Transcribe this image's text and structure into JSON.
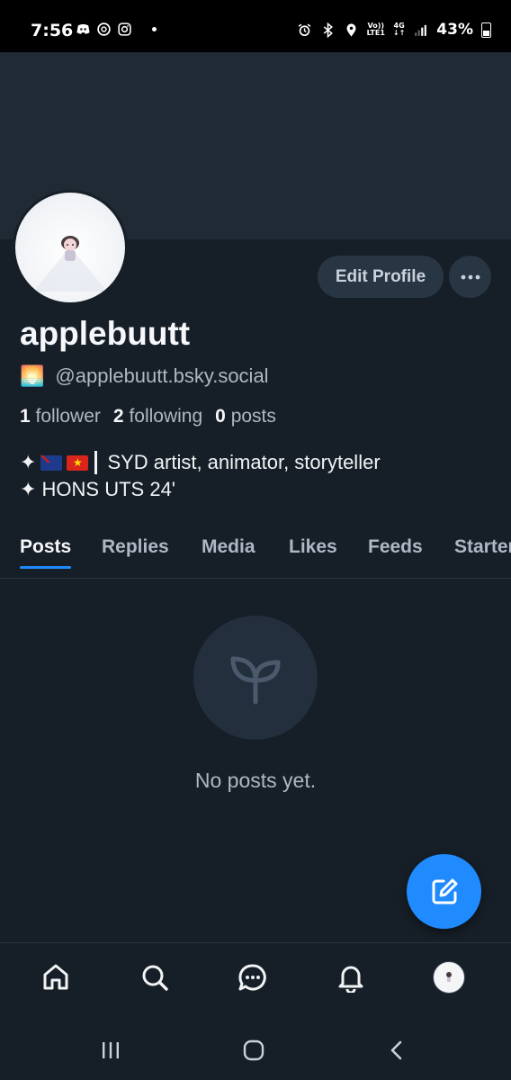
{
  "status_bar": {
    "time": "7:56",
    "left_icons": [
      "discord-icon",
      "threads-icon",
      "instagram-icon"
    ],
    "right_icons": [
      "alarm-icon",
      "bluetooth-icon",
      "location-icon"
    ],
    "volte_top": "Vo))",
    "volte_bottom": "LTE1",
    "network_top": "4G",
    "network_bottom": "↓↑",
    "battery": "43%"
  },
  "profile": {
    "display_name": "applebuutt",
    "handle_emoji": "🌅",
    "handle": "@applebuutt.bsky.social",
    "followers_count": "1",
    "followers_label": "follower",
    "following_count": "2",
    "following_label": "following",
    "posts_count": "0",
    "posts_label": "posts",
    "bio_line1_prefix": "✦",
    "bio_line1_text": "SYD artist, animator, storyteller",
    "bio_line2": "✦ HONS UTS 24'"
  },
  "actions": {
    "edit_profile": "Edit Profile",
    "more_icon": "ellipsis-icon"
  },
  "tabs": [
    {
      "label": "Posts",
      "active": true
    },
    {
      "label": "Replies",
      "active": false
    },
    {
      "label": "Media",
      "active": false
    },
    {
      "label": "Likes",
      "active": false
    },
    {
      "label": "Feeds",
      "active": false
    },
    {
      "label": "Starter",
      "active": false
    }
  ],
  "empty_state": {
    "icon": "sprout-icon",
    "text": "No posts yet."
  },
  "fab_icon": "compose-icon",
  "bottom_nav": [
    "home-icon",
    "search-icon",
    "chat-icon",
    "bell-icon",
    "profile-avatar"
  ],
  "colors": {
    "background": "#161e27",
    "banner": "#1f2a35",
    "accent": "#208bfe",
    "muted_text": "#aeb8c4"
  }
}
